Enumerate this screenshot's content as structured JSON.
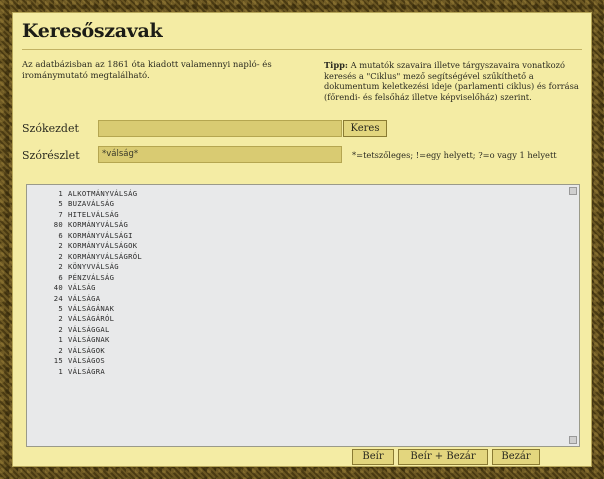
{
  "header": {
    "title": "Keresőszavak",
    "description": "Az adatbázisban az 1861 óta kiadott valamennyi napló- és irománymutató megtalálható.",
    "tip_label": "Tipp:",
    "tip_text": " A mutatók szavaira illetve tárgyszavaira vonatkozó keresés a \"Ciklus\" mező segítségével szűkíthető a dokumentum keletkezési ideje (parlamenti ciklus) és forrása (főrendi- és felsőház illetve képviselőház) szerint."
  },
  "search": {
    "prefix_label": "Szókezdet",
    "prefix_value": "",
    "search_button": "Keres",
    "part_label": "Szórészlet",
    "part_value": "*válság*",
    "hint": "*=tetszőleges;   !=egy helyett;   ?=o vagy 1 helyett"
  },
  "results": [
    {
      "count": "1",
      "word": "ALKOTMÁNYVÁLSÁG"
    },
    {
      "count": "5",
      "word": "BUZAVÁLSÁG"
    },
    {
      "count": "7",
      "word": "HITELVÁLSÁG"
    },
    {
      "count": "80",
      "word": "KORMÁNYVÁLSÁG"
    },
    {
      "count": "6",
      "word": "KORMÁNYVÁLSÁGI"
    },
    {
      "count": "2",
      "word": "KORMÁNYVÁLSÁGOK"
    },
    {
      "count": "2",
      "word": "KORMÁNYVÁLSÁGRÓL"
    },
    {
      "count": "2",
      "word": "KÖNYVVÁLSÁG"
    },
    {
      "count": "6",
      "word": "PÉNZVÁLSÁG"
    },
    {
      "count": "40",
      "word": "VÁLSÁG"
    },
    {
      "count": "24",
      "word": "VÁLSÁGA"
    },
    {
      "count": "5",
      "word": "VÁLSÁGÁNAK"
    },
    {
      "count": "2",
      "word": "VÁLSÁGÁRÓL"
    },
    {
      "count": "2",
      "word": "VÁLSÁGGAL"
    },
    {
      "count": "1",
      "word": "VÁLSÁGNAK"
    },
    {
      "count": "2",
      "word": "VÁLSÁGOK"
    },
    {
      "count": "15",
      "word": "VÁLSÁGOS"
    },
    {
      "count": "1",
      "word": "VÁLSÁGRA"
    }
  ],
  "footer": {
    "insert_button": "Beír",
    "insert_close_button": "Beír + Bezár",
    "close_button": "Bezár"
  },
  "colors": {
    "panel": "#f4eca4",
    "field": "#d9cb72",
    "results_bg": "#e8e9ea",
    "frame": "#5a4a1e"
  }
}
